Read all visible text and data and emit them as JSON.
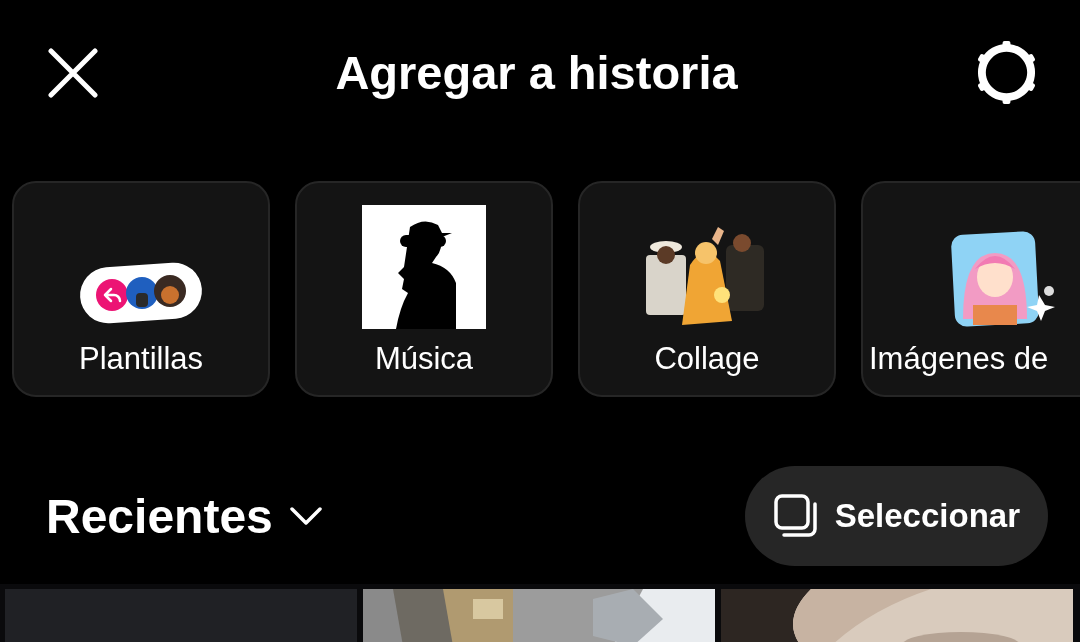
{
  "header": {
    "title": "Agregar a historia"
  },
  "shortcuts": [
    {
      "label": "Plantillas",
      "kind": "templates"
    },
    {
      "label": "Música",
      "kind": "music"
    },
    {
      "label": "Collage",
      "kind": "collage"
    },
    {
      "label": "Imágenes de",
      "kind": "images"
    }
  ],
  "gallery": {
    "title": "Recientes",
    "select_button": "Seleccionar",
    "tiles": [
      {
        "kind": "blank"
      },
      {
        "kind": "trees"
      },
      {
        "kind": "closeup"
      }
    ]
  }
}
